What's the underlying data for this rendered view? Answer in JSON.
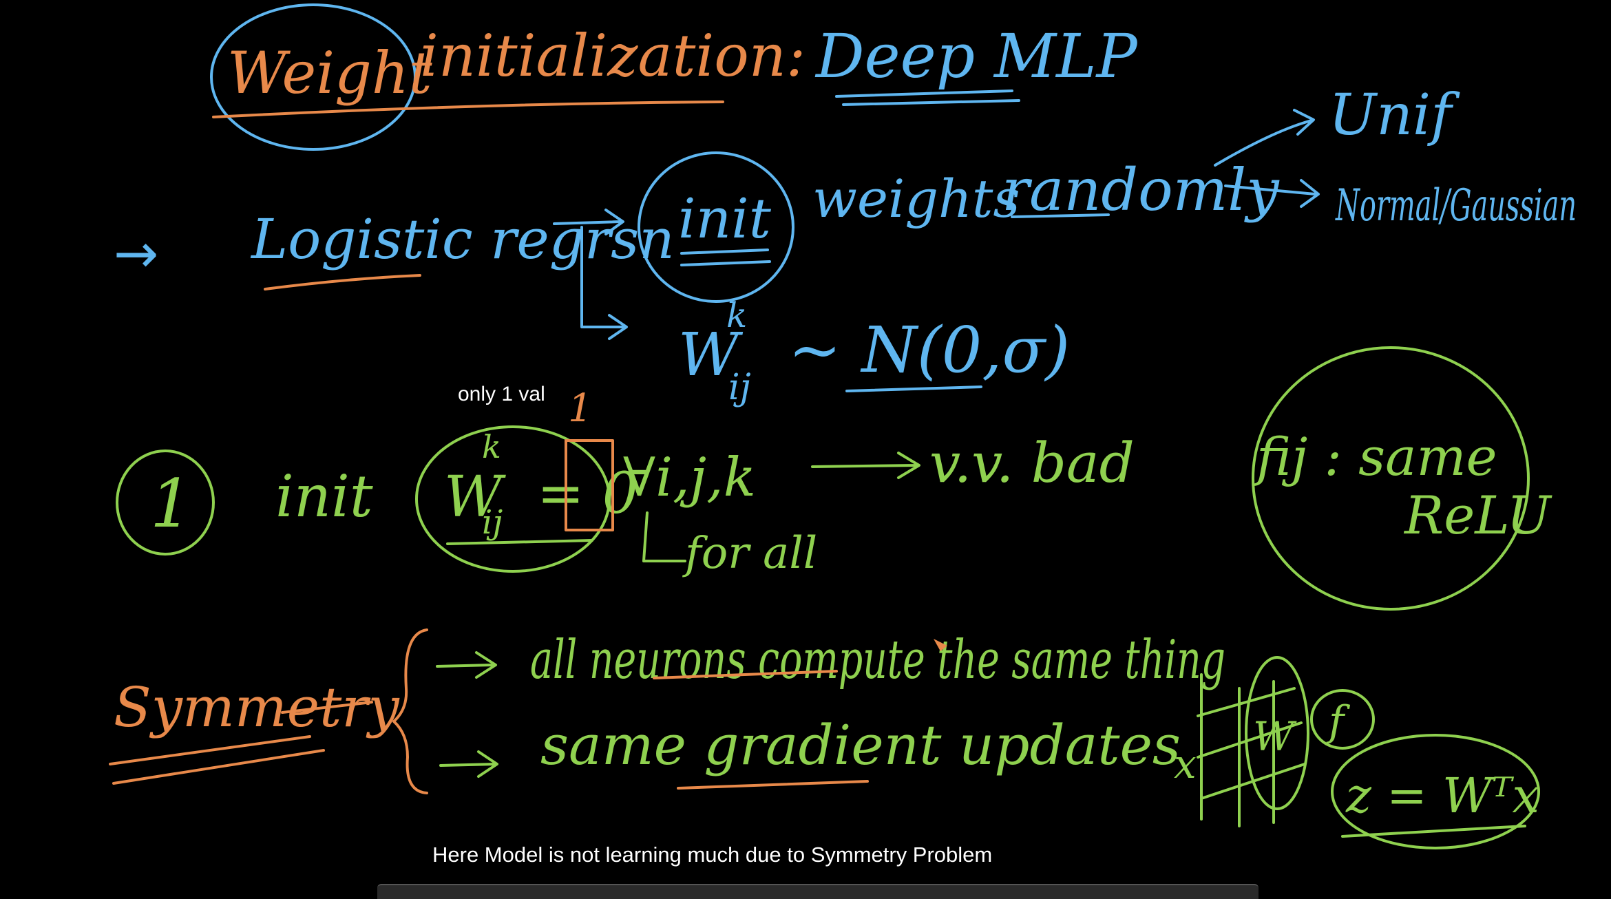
{
  "colors": {
    "background": "#000000",
    "orange": "#e8894a",
    "blue": "#5fb6f0",
    "green": "#8fd14f",
    "caption": "#ffffff"
  },
  "board": {
    "title_weight": "Weight",
    "title_rest": "initialization:",
    "title_deep": "Deep MLP",
    "arrow_glyph": "→",
    "logistic": "Logistic regrsn",
    "init": "init",
    "weights": "weights",
    "randomly": "randomly",
    "unif": "Unif",
    "normal": "Normal/Gaussian",
    "w": "W",
    "w_sup": "k",
    "w_sub": "ij",
    "dist": "~ N(0,σ)",
    "num1": "1",
    "init1": "init",
    "eq": "= 0",
    "one_above": "1",
    "forall": "∀i,j,k",
    "vvbad": "v.v. bad",
    "forall_note": "for all",
    "fij": "fij : same",
    "relu": "ReLU",
    "symmetry": "Symmetry",
    "line1": "all neurons compute the same thing",
    "line2": "same gradient updates",
    "diag_x": "x",
    "diag_w": "W",
    "diag_f": "f",
    "diag_z": "z = Wᵀx"
  },
  "annotations": {
    "only_one_val": "only 1 val",
    "caption": "Here Model is not learning much due to Symmetry Problem"
  }
}
